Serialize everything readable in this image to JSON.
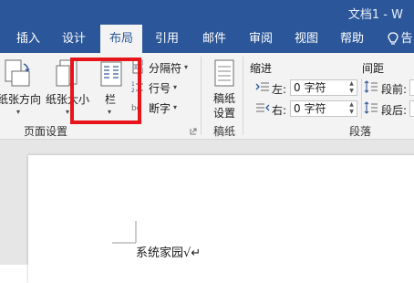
{
  "window": {
    "title": "文档1 - W"
  },
  "tabs": [
    {
      "label": "插入"
    },
    {
      "label": "设计"
    },
    {
      "label": "布局"
    },
    {
      "label": "引用"
    },
    {
      "label": "邮件"
    },
    {
      "label": "审阅"
    },
    {
      "label": "视图"
    },
    {
      "label": "帮助"
    },
    {
      "label": "告"
    }
  ],
  "ribbon": {
    "page_setup": {
      "orientation_label": "纸张方向",
      "size_label": "纸张大小",
      "columns_label": "栏",
      "breaks_label": "分隔符",
      "line_numbers_label": "行号",
      "hyphenation_label": "断字",
      "group_label": "页面设置"
    },
    "draft": {
      "button_label_1": "稿纸",
      "button_label_2": "设置",
      "group_label": "稿纸"
    },
    "paragraph": {
      "indent_header": "缩进",
      "spacing_header": "间距",
      "left_label": "左:",
      "left_value": "0 字符",
      "right_label": "右:",
      "right_value": "0 字符",
      "before_label": "段前:",
      "after_label": "段后:",
      "group_label": "段落"
    }
  },
  "document": {
    "text": "系统家园√↵"
  },
  "colors": {
    "brand": "#2b579a",
    "highlight_border": "#e8141b"
  }
}
